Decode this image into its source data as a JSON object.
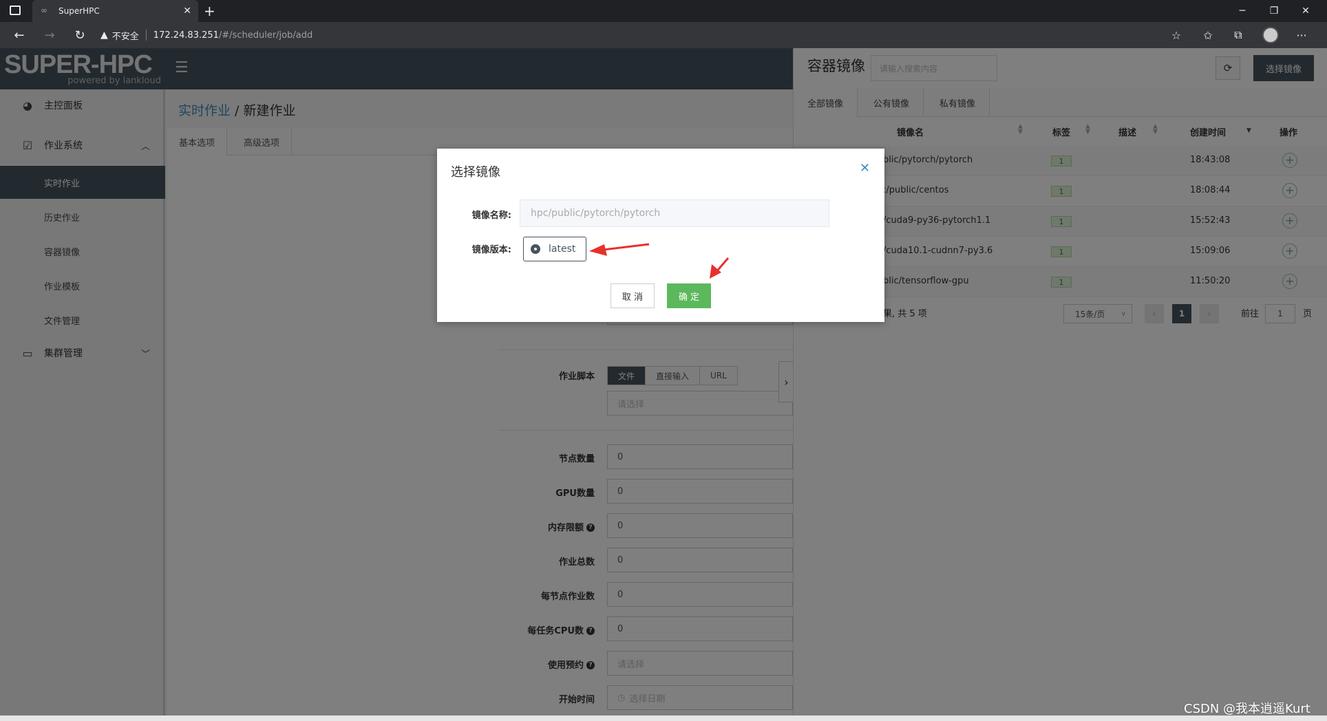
{
  "browser": {
    "tab_title": "SuperHPC",
    "security_label": "不安全",
    "url_host": "172.24.83.251",
    "url_path": "/#/scheduler/job/add"
  },
  "app": {
    "logo_main": "SUPER-HPC",
    "logo_sub": "powered by lankloud"
  },
  "sidebar": {
    "items": [
      {
        "label": "主控面板"
      },
      {
        "label": "作业系统"
      },
      {
        "label": "实时作业"
      },
      {
        "label": "历史作业"
      },
      {
        "label": "容器镜像"
      },
      {
        "label": "作业模板"
      },
      {
        "label": "文件管理"
      },
      {
        "label": "集群管理"
      }
    ]
  },
  "content": {
    "breadcrumb_link": "实时作业",
    "breadcrumb_sep": " / ",
    "breadcrumb_current": "新建作业",
    "tabs": [
      {
        "label": "基本选项"
      },
      {
        "label": "高级选项"
      }
    ],
    "form": {
      "script_label": "作业脚本",
      "script_modes": [
        {
          "label": "文件"
        },
        {
          "label": "直接输入"
        },
        {
          "label": "URL"
        }
      ],
      "script_placeholder": "请选择",
      "fields": [
        {
          "label": "节点数量",
          "value": "0"
        },
        {
          "label": "GPU数量",
          "value": "0"
        },
        {
          "label": "内存限额",
          "value": "0"
        },
        {
          "label": "作业总数",
          "value": "0"
        },
        {
          "label": "每节点作业数",
          "value": "0"
        },
        {
          "label": "每任务CPU数",
          "value": "0"
        },
        {
          "label": "使用预约",
          "placeholder": "请选择"
        },
        {
          "label": "开始时间",
          "placeholder": "选择日期"
        }
      ]
    }
  },
  "panel": {
    "title": "容器镜像",
    "search_placeholder": "请输入搜索内容",
    "select_button": "选择镜像",
    "tabs": [
      {
        "label": "全部镜像"
      },
      {
        "label": "公有镜像"
      },
      {
        "label": "私有镜像"
      }
    ],
    "columns": {
      "name": "镜像名",
      "tag": "标签",
      "desc": "描述",
      "created": "创建时间",
      "op": "操作"
    },
    "rows": [
      {
        "name": "blic/pytorch/pytorch",
        "tag": "1",
        "time": "18:43:08"
      },
      {
        "name": ":/public/centos",
        "tag": "1",
        "time": "18:08:44"
      },
      {
        "name": "/cuda9-py36-pytorch1.1",
        "tag": "1",
        "time": "15:52:43"
      },
      {
        "name": "/cuda10.1-cudnn7-py3.6",
        "tag": "1",
        "time": "15:09:06"
      },
      {
        "name": "blic/tensorflow-gpu",
        "tag": "1",
        "time": "11:50:20"
      }
    ],
    "footer_text": "果, 共 5 项",
    "page_size": "15条/页",
    "current_page": "1",
    "goto_label": "前往",
    "goto_value": "1",
    "page_unit": "页"
  },
  "modal": {
    "title": "选择镜像",
    "name_label": "镜像名称:",
    "name_value": "hpc/public/pytorch/pytorch",
    "version_label": "镜像版本:",
    "version_option": "latest",
    "cancel_label": "取 消",
    "ok_label": "确 定"
  },
  "watermark": "CSDN @我本逍遥Kurt",
  "colors": {
    "header_bg": "#47545e",
    "confirm_green": "#5cb85c",
    "link_blue": "#3c8dbc",
    "arrow_red": "#e8302c"
  }
}
